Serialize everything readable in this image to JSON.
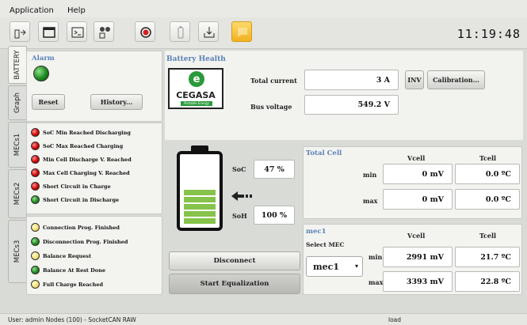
{
  "menu": {
    "application": "Application",
    "help": "Help"
  },
  "toolbar": {
    "buttons": [
      "connect-icon",
      "folder-icon",
      "terminal-icon",
      "settings-nodes-icon",
      "record-icon",
      "battery-icon",
      "download-icon",
      "chat-icon"
    ]
  },
  "clock": "11:19:48",
  "tabs": [
    "BATTERY",
    "Graph",
    "MECs1",
    "MECs2",
    "MECs3"
  ],
  "alarm": {
    "title": "Alarm",
    "reset": "Reset",
    "history": "History...",
    "main_led": "green",
    "items": [
      {
        "label": "SoC Min Reached Discharging",
        "state": "red"
      },
      {
        "label": "SoC Max Reached Charging",
        "state": "red"
      },
      {
        "label": "Min Cell Discharge V. Reached",
        "state": "red"
      },
      {
        "label": "Max Cell Charging V. Reached",
        "state": "red"
      },
      {
        "label": "Short Circuit in Charge",
        "state": "red"
      },
      {
        "label": "Short Circuit in Discharge",
        "state": "green"
      }
    ],
    "status_items": [
      {
        "label": "Connection Prog. Finished",
        "state": "yellow"
      },
      {
        "label": "Disconnection Prog. Finished",
        "state": "green"
      },
      {
        "label": "Balance Request",
        "state": "yellow"
      },
      {
        "label": "Balance At Rest Done",
        "state": "green"
      },
      {
        "label": "Full Charge Reached",
        "state": "yellow"
      }
    ]
  },
  "battery": {
    "title": "Battery Health",
    "logo_text": "CEGASA",
    "logo_sub": "Portable Energy",
    "total_current_label": "Total current",
    "total_current": "3 A",
    "inv": "INV",
    "calibration": "Calibration...",
    "bus_voltage_label": "Bus voltage",
    "bus_voltage": "549.2 V",
    "soc_label": "SoC",
    "soc": "47 %",
    "soh_label": "SoH",
    "soh": "100 %",
    "fill_fraction": 0.47,
    "disconnect": "Disconnect",
    "start_equalization": "Start Equalization"
  },
  "total_cell": {
    "title": "Total Cell",
    "vcell": "Vcell",
    "tcell": "Tcell",
    "min_label": "min",
    "max_label": "max",
    "min_v": "0 mV",
    "min_t": "0.0 ºC",
    "max_v": "0 mV",
    "max_t": "0.0 ºC"
  },
  "mec": {
    "title": "mec1",
    "select_label": "Select MEC",
    "selected": "mec1",
    "vcell": "Vcell",
    "tcell": "Tcell",
    "min_label": "min",
    "max_label": "max",
    "min_v": "2991 mV",
    "min_t": "21.7 ºC",
    "max_v": "3393 mV",
    "max_t": "22.8 ºC"
  },
  "status": {
    "left": "User: admin  Nodes (100) - SocketCAN RAW",
    "center": "load"
  }
}
